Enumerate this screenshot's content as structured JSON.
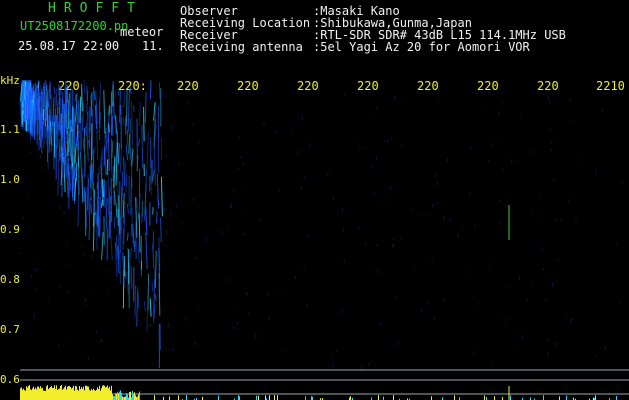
{
  "app": {
    "title": "HROFFT"
  },
  "header": {
    "filename": "UT2508172200.pn",
    "mode": "meteor",
    "datetime": "25.08.17 22:00",
    "count": "11.",
    "fields": [
      {
        "label": "Observer",
        "value": ":Masaki Kano"
      },
      {
        "label": "Receiving Location",
        "value": ":Shibukawa,Gunma,Japan"
      },
      {
        "label": "Receiver",
        "value": ":RTL-SDR SDR# 43dB L15 114.1MHz USB"
      },
      {
        "label": "Receiving antenna",
        "value": ":5el Yagi Az 20 for Aomori VOR"
      }
    ]
  },
  "axes": {
    "y_unit": "kHz",
    "y_ticks": [
      "1.1",
      "1.0",
      "0.9",
      "0.8",
      "0.7",
      "0.6"
    ],
    "x_ticks": [
      "220",
      "220:",
      "220",
      "220",
      "220",
      "220",
      "220",
      "220",
      "220",
      "2210"
    ]
  },
  "colors": {
    "background": "#000000",
    "text_green": "#2fd62f",
    "text_yellow": "#f2ee2a",
    "trace_blue": "#1a5cff",
    "trace_cyan": "#25d9ff",
    "power_yellow": "#f2ee2a",
    "guide_line": "#bbbbbb"
  }
}
